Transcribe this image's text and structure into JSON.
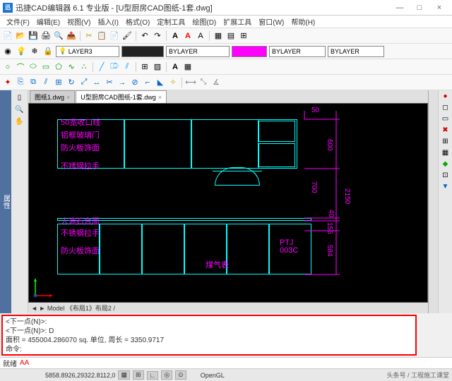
{
  "title": "迅捷CAD编辑器 6.1 专业版 - [U型厨房CAD图纸-1套.dwg]",
  "menus": [
    "文件(F)",
    "编辑(E)",
    "视图(V)",
    "插入(I)",
    "格式(O)",
    "定制工具",
    "绘图(D)",
    "扩展工具",
    "窗口(W)",
    "帮助(H)"
  ],
  "layer_name": "LAYER3",
  "bylayer1": "BYLAYER",
  "bylayer2": "BYLAYER",
  "bylayer3": "BYLAYER",
  "prop_label": "属性",
  "tabs": [
    {
      "label": "图纸1.dwg",
      "active": false
    },
    {
      "label": "U型厨房CAD图纸-1套.dwg",
      "active": true
    }
  ],
  "labels": {
    "l1": "50宽收口线",
    "l2": "铝框玻璃门",
    "l3": "防火板饰面",
    "l4": "不锈钢拉手",
    "l5": "人造石台面",
    "l6": "不锈钢拉手",
    "l7": "防火板饰面",
    "l8": "煤气表",
    "l9": "PTJ\n003C"
  },
  "dims": {
    "d700": "700",
    "d600": "600",
    "d40": "40",
    "d156": "156",
    "d584": "584",
    "d2150": "2150",
    "d50": "50"
  },
  "bottom_tabs": "◄ ► Model 《布局1》布局2 /",
  "cmd_lines": [
    "<下一点(N)>:",
    "<下一点(N)>: D",
    "面积 = 455004.286070 sq. 单位,  周长 = 3350.9717",
    "命令:"
  ],
  "cmd_prompt": "就绪",
  "cmd_input": "AA",
  "status_coord": "5858.8926,29322.8112,0",
  "status_opengl": "OpenGL",
  "watermark": "头条号 / 工程施工课堂"
}
